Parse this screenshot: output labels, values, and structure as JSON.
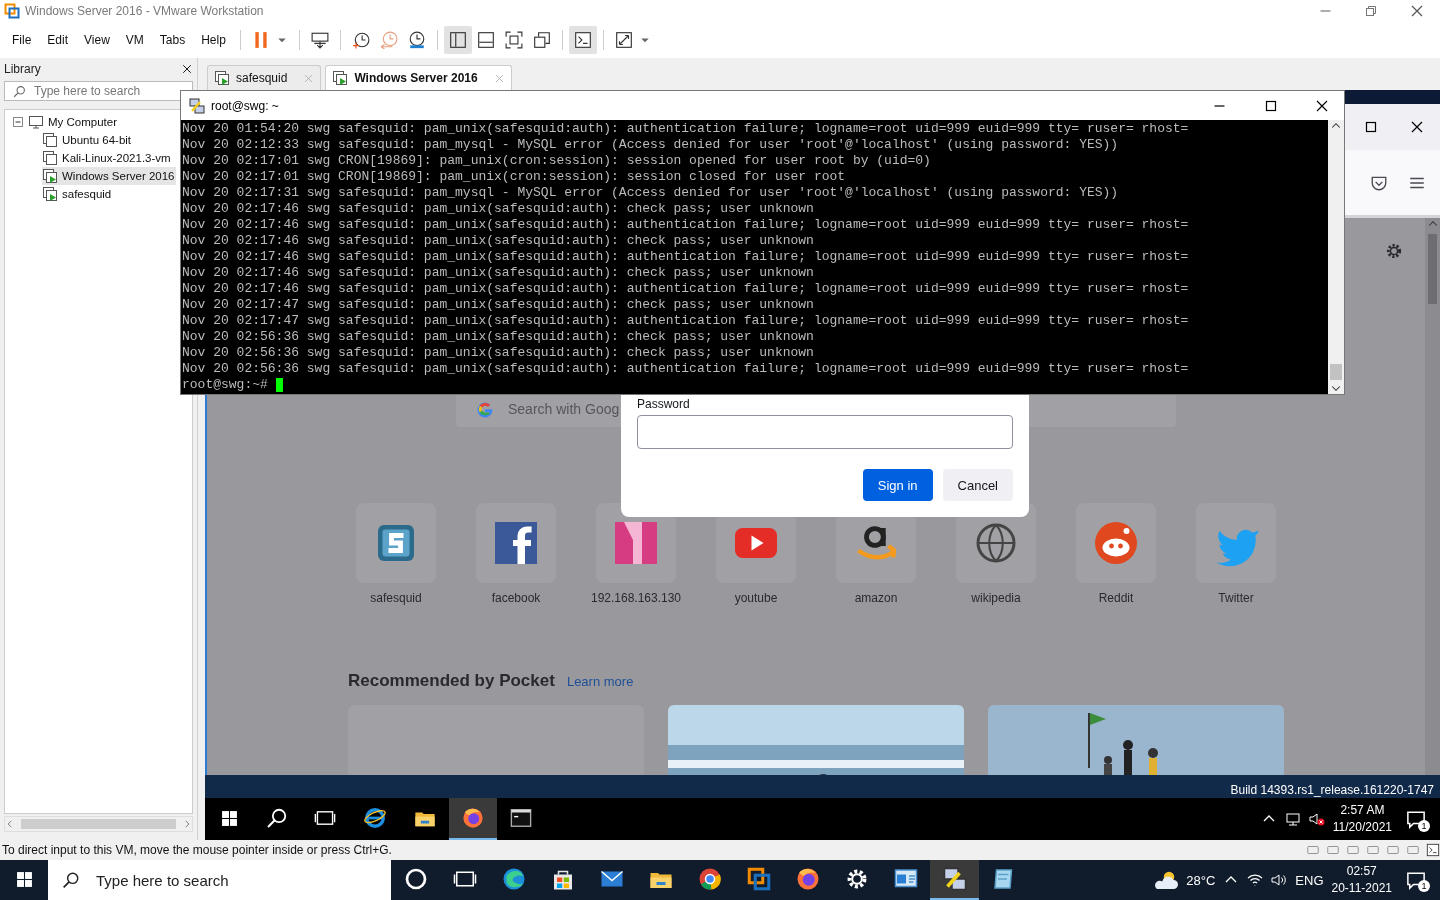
{
  "host_window": {
    "title": "Windows Server 2016 - VMware Workstation"
  },
  "menu": [
    "File",
    "Edit",
    "View",
    "VM",
    "Tabs",
    "Help"
  ],
  "toolbar": [
    {
      "kind": "pause",
      "dropdown": true,
      "pressed": false
    },
    {
      "kind": "send-keys",
      "dropdown": false,
      "pressed": false
    },
    {
      "kind": "snapshot",
      "dropdown": false,
      "pressed": false
    },
    {
      "kind": "revert",
      "dropdown": false,
      "pressed": false
    },
    {
      "kind": "manager",
      "dropdown": false,
      "pressed": false
    },
    {
      "kind": "library-view",
      "dropdown": false,
      "pressed": true
    },
    {
      "kind": "thumbnail-view",
      "dropdown": false,
      "pressed": false
    },
    {
      "kind": "full-screen",
      "dropdown": false,
      "pressed": false
    },
    {
      "kind": "unity",
      "dropdown": false,
      "pressed": false
    },
    {
      "kind": "console",
      "dropdown": false,
      "pressed": true
    },
    {
      "kind": "stretch",
      "dropdown": true,
      "pressed": false
    }
  ],
  "library": {
    "title": "Library",
    "search_placeholder": "Type here to search",
    "tree": [
      {
        "label": "My Computer",
        "expanded": true,
        "selected": false,
        "children": [
          {
            "label": "Ubuntu 64-bit",
            "running": false,
            "selected": false
          },
          {
            "label": "Kali-Linux-2021.3-vm",
            "running": false,
            "selected": false
          },
          {
            "label": "Windows Server 2016",
            "running": true,
            "selected": true
          },
          {
            "label": "safesquid",
            "running": true,
            "selected": false
          }
        ]
      }
    ]
  },
  "tabs": [
    {
      "label": "safesquid",
      "selected": false
    },
    {
      "label": "Windows Server 2016",
      "selected": true
    }
  ],
  "terminal": {
    "title": "root@swg: ~",
    "prompt": "root@swg:~#",
    "lines": [
      "Nov 20 01:54:20 swg safesquid: pam_unix(safesquid:auth): authentication failure; logname=root uid=999 euid=999 tty= ruser= rhost=",
      "Nov 20 02:12:33 swg safesquid: pam_mysql - MySQL error (Access denied for user 'root'@'localhost' (using password: YES))",
      "Nov 20 02:17:01 swg CRON[19869]: pam_unix(cron:session): session opened for user root by (uid=0)",
      "Nov 20 02:17:01 swg CRON[19869]: pam_unix(cron:session): session closed for user root",
      "Nov 20 02:17:31 swg safesquid: pam_mysql - MySQL error (Access denied for user 'root'@'localhost' (using password: YES))",
      "Nov 20 02:17:46 swg safesquid: pam_unix(safesquid:auth): check pass; user unknown",
      "Nov 20 02:17:46 swg safesquid: pam_unix(safesquid:auth): authentication failure; logname=root uid=999 euid=999 tty= ruser= rhost=",
      "Nov 20 02:17:46 swg safesquid: pam_unix(safesquid:auth): check pass; user unknown",
      "Nov 20 02:17:46 swg safesquid: pam_unix(safesquid:auth): authentication failure; logname=root uid=999 euid=999 tty= ruser= rhost=",
      "Nov 20 02:17:46 swg safesquid: pam_unix(safesquid:auth): check pass; user unknown",
      "Nov 20 02:17:46 swg safesquid: pam_unix(safesquid:auth): authentication failure; logname=root uid=999 euid=999 tty= ruser= rhost=",
      "Nov 20 02:17:47 swg safesquid: pam_unix(safesquid:auth): check pass; user unknown",
      "Nov 20 02:17:47 swg safesquid: pam_unix(safesquid:auth): authentication failure; logname=root uid=999 euid=999 tty= ruser= rhost=",
      "Nov 20 02:56:36 swg safesquid: pam_unix(safesquid:auth): check pass; user unknown",
      "Nov 20 02:56:36 swg safesquid: pam_unix(safesquid:auth): check pass; user unknown",
      "Nov 20 02:56:36 swg safesquid: pam_unix(safesquid:auth): authentication failure; logname=root uid=999 euid=999 tty= ruser= rhost="
    ]
  },
  "firefox": {
    "search_placeholder": "Search with Goog",
    "top_sites": [
      {
        "label": "safesquid",
        "kind": "safesquid"
      },
      {
        "label": "facebook",
        "kind": "facebook"
      },
      {
        "label": "192.168.163.130",
        "kind": "pink"
      },
      {
        "label": "youtube",
        "kind": "youtube"
      },
      {
        "label": "amazon",
        "kind": "amazon"
      },
      {
        "label": "wikipedia",
        "kind": "wikipedia"
      },
      {
        "label": "Reddit",
        "kind": "reddit"
      },
      {
        "label": "Twitter",
        "kind": "twitter"
      }
    ],
    "pocket": {
      "heading": "Recommended by Pocket",
      "link": "Learn more",
      "cards": [
        {
          "kind": "blank"
        },
        {
          "kind": "picture"
        },
        {
          "kind": "picture"
        }
      ]
    }
  },
  "dialog": {
    "field_label": "Password",
    "buttons": [
      {
        "label": "Sign in",
        "kind": "primary"
      },
      {
        "label": "Cancel",
        "kind": "secondary"
      }
    ]
  },
  "guest_desktop": {
    "build": "Build 14393.rs1_release.161220-1747"
  },
  "guest_taskbar": {
    "apps": [
      {
        "kind": "start",
        "active": false
      },
      {
        "kind": "search",
        "active": false
      },
      {
        "kind": "taskview",
        "active": false
      },
      {
        "kind": "ie",
        "active": false
      },
      {
        "kind": "explorer",
        "active": false
      },
      {
        "kind": "firefox",
        "active": true
      },
      {
        "kind": "cmd",
        "active": false
      }
    ],
    "time": "2:57 AM",
    "date": "11/20/2021",
    "notifications": "1"
  },
  "status_bar": {
    "message": "To direct input to this VM, move the mouse pointer inside or press Ctrl+G."
  },
  "host_taskbar": {
    "search_placeholder": "Type here to search",
    "apps": [
      {
        "kind": "cortana",
        "active": false
      },
      {
        "kind": "taskview",
        "active": false
      },
      {
        "kind": "edge",
        "active": false
      },
      {
        "kind": "store",
        "active": false
      },
      {
        "kind": "mail",
        "active": false
      },
      {
        "kind": "explorer",
        "active": false
      },
      {
        "kind": "chrome",
        "active": false
      },
      {
        "kind": "vmware",
        "active": false
      },
      {
        "kind": "firefox",
        "active": false
      },
      {
        "kind": "settings",
        "active": false
      },
      {
        "kind": "remote",
        "active": false
      },
      {
        "kind": "putty",
        "active": true
      },
      {
        "kind": "notepad",
        "active": false
      }
    ],
    "weather": "28°C",
    "language": "ENG",
    "time": "02:57",
    "date": "20-11-2021",
    "notifications": "1"
  }
}
